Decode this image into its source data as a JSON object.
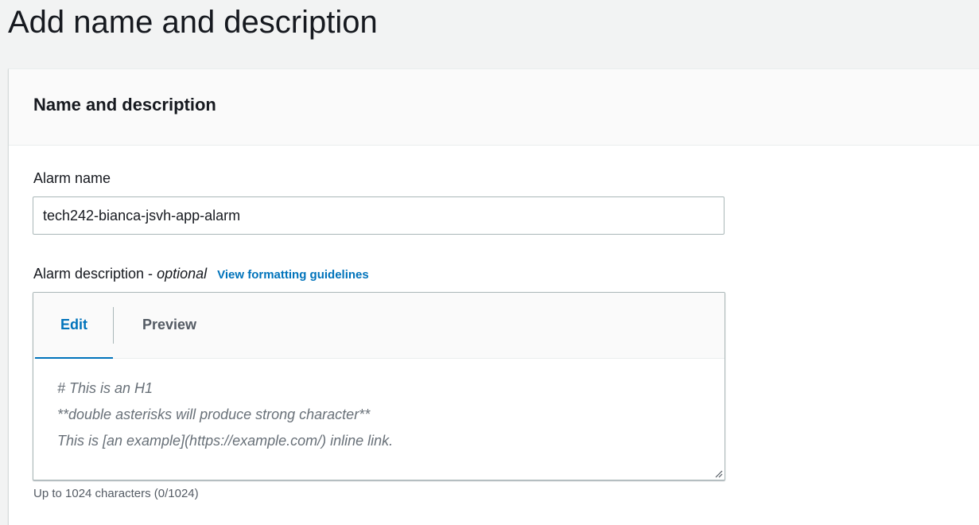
{
  "page": {
    "title": "Add name and description"
  },
  "panel": {
    "header": "Name and description"
  },
  "alarm_name": {
    "label": "Alarm name",
    "value": "tech242-bianca-jsvh-app-alarm"
  },
  "alarm_description": {
    "label": "Alarm description - ",
    "optional": "optional",
    "info_link": "View formatting guidelines",
    "tabs": [
      {
        "label": "Edit",
        "selected": true
      },
      {
        "label": "Preview",
        "selected": false
      }
    ],
    "value": "",
    "placeholder_lines": [
      "# This is an H1",
      "**double asterisks will produce strong character**",
      "This is [an example](https://example.com/) inline link."
    ],
    "constraint": "Up to 1024 characters (0/1024)"
  },
  "colors": {
    "accent": "#0073bb",
    "page_background": "#f2f3f3",
    "text": "#16191f",
    "secondary_text": "#545b64"
  },
  "icons": {
    "resize": "resize-handle-icon"
  }
}
